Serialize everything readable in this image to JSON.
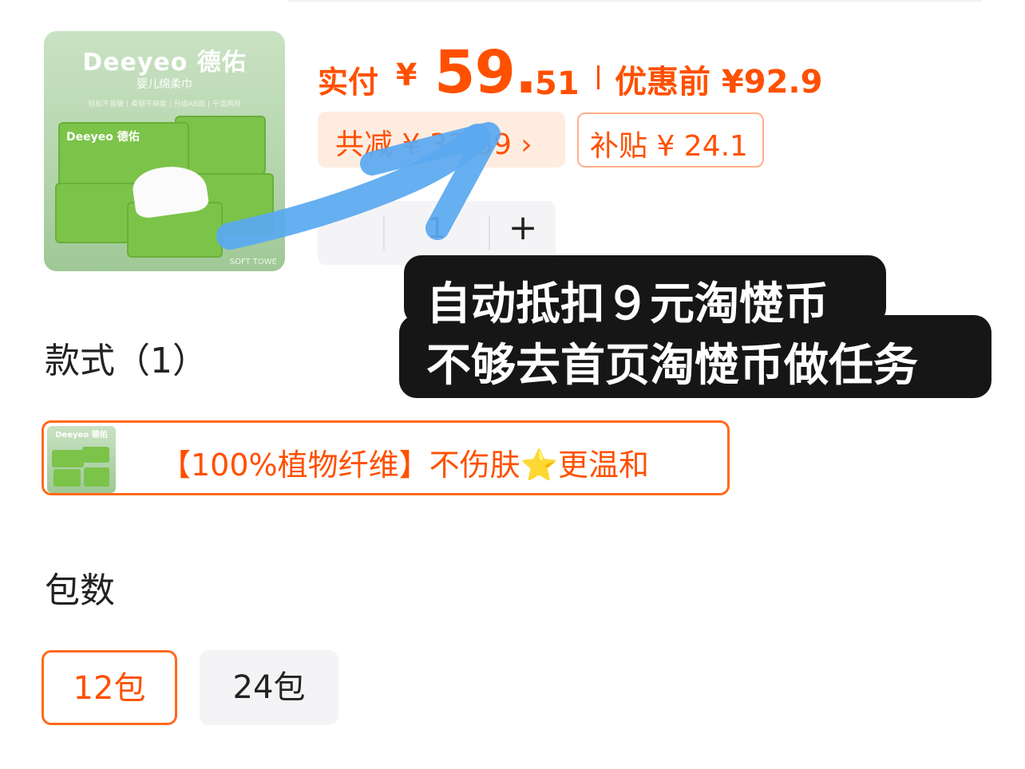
{
  "product": {
    "brand": "Deeyeo 德佑",
    "subtitle": "婴儿绵柔巾",
    "features": "轻松不易破 | 柔韧不掉絮 | 升级AB面 | 干湿两用",
    "package_label": "Deeyeo 德佑",
    "tag": "SOFT TOWE"
  },
  "price": {
    "label": "实付",
    "currency": "¥",
    "integer": "59.",
    "decimal": "51",
    "before_label": "优惠前 ¥92.9"
  },
  "tags": {
    "discount": "共减 ¥ 33.39 ›",
    "subsidy": "补贴 ¥ 24.1"
  },
  "stepper": {
    "value": "1",
    "plus": "+"
  },
  "annotation": {
    "line1": "自动抵扣９元淘憷币",
    "line2": "不够去首页淘憷币做任务"
  },
  "sections": {
    "style_title": "款式（1）",
    "pack_title": "包数"
  },
  "style_options": [
    {
      "label": "【100%植物纤维】不伤肤⭐更温和",
      "thumb_brand": "Deeyeo 德佑",
      "selected": true
    }
  ],
  "pack_options": [
    {
      "label": "12包",
      "selected": true
    },
    {
      "label": "24包",
      "selected": false
    }
  ],
  "colors": {
    "accent": "#ff5000",
    "selected_border": "#ff6a1a",
    "arrow": "#5aa9f0",
    "bubble": "#161616"
  }
}
